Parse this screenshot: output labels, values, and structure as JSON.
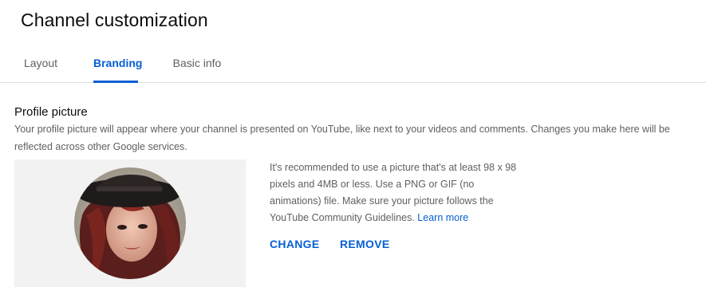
{
  "header": {
    "title": "Channel customization"
  },
  "tabs": [
    {
      "label": "Layout",
      "active": false
    },
    {
      "label": "Branding",
      "active": true
    },
    {
      "label": "Basic info",
      "active": false
    }
  ],
  "profile_picture": {
    "title": "Profile picture",
    "description_line1": "Your profile picture will appear where your channel is presented on YouTube, like next to your videos and comments. Changes you make here will be",
    "description_line2": "reflected across other Google services.",
    "info_line1": "It's recommended to use a picture that's at least 98 x 98",
    "info_line2": "pixels and 4MB or less. Use a PNG or GIF (no",
    "info_line3": "animations) file. Make sure your picture follows the",
    "info_line4": "YouTube Community Guidelines.",
    "learn_more": "Learn more",
    "change_label": "CHANGE",
    "remove_label": "REMOVE"
  },
  "colors": {
    "accent": "#065fd4",
    "secondary_text": "#606060",
    "preview_background": "#f2f2f2"
  }
}
